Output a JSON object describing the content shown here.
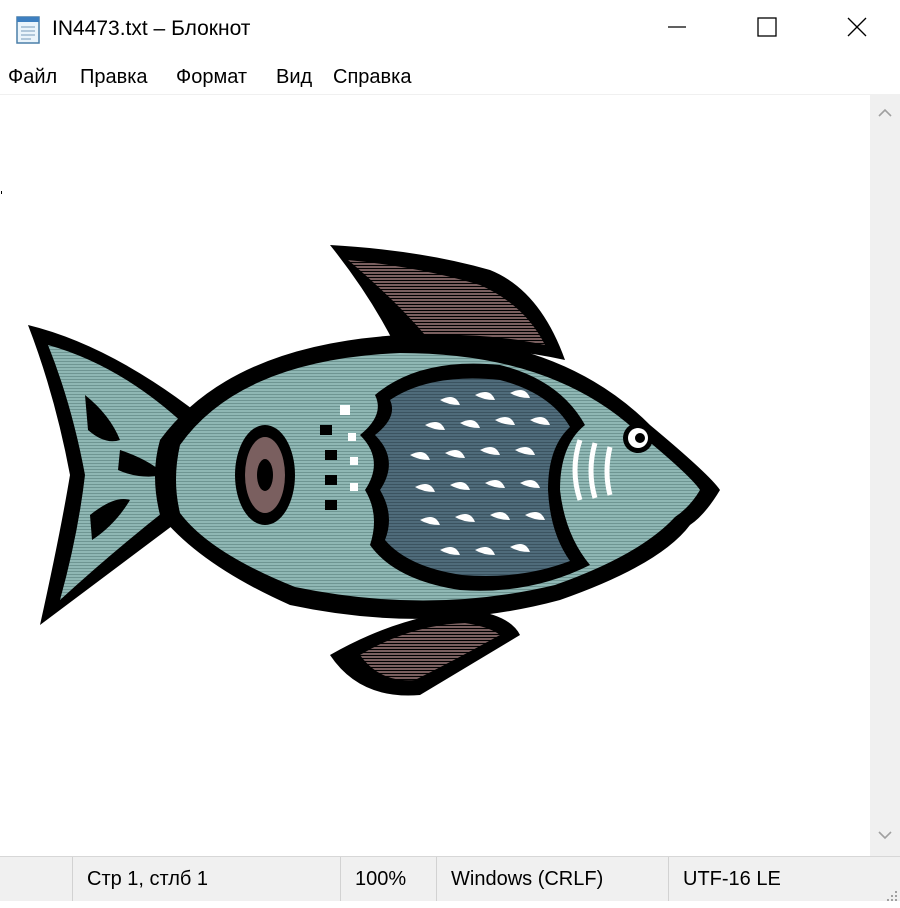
{
  "window": {
    "title": "IN4473.txt – Блокнот",
    "icon": "notepad-icon",
    "controls": [
      "minimize-icon",
      "maximize-icon",
      "close-icon"
    ]
  },
  "menu": {
    "items": [
      {
        "label": "Файл"
      },
      {
        "label": "Правка"
      },
      {
        "label": "Формат"
      },
      {
        "label": "Вид"
      },
      {
        "label": "Справка"
      }
    ]
  },
  "editor": {
    "content_image": "fish-illustration"
  },
  "status": {
    "position": "Стр 1, стлб 1",
    "zoom": "100%",
    "line_endings": "Windows (CRLF)",
    "encoding": "UTF-16 LE"
  },
  "colors": {
    "fish_body": "#8fb7b4",
    "fish_scales": "#4f6b7a",
    "fin": "#7a5f5f",
    "outline": "#000000",
    "statusbar_bg": "#f0f0f0"
  }
}
